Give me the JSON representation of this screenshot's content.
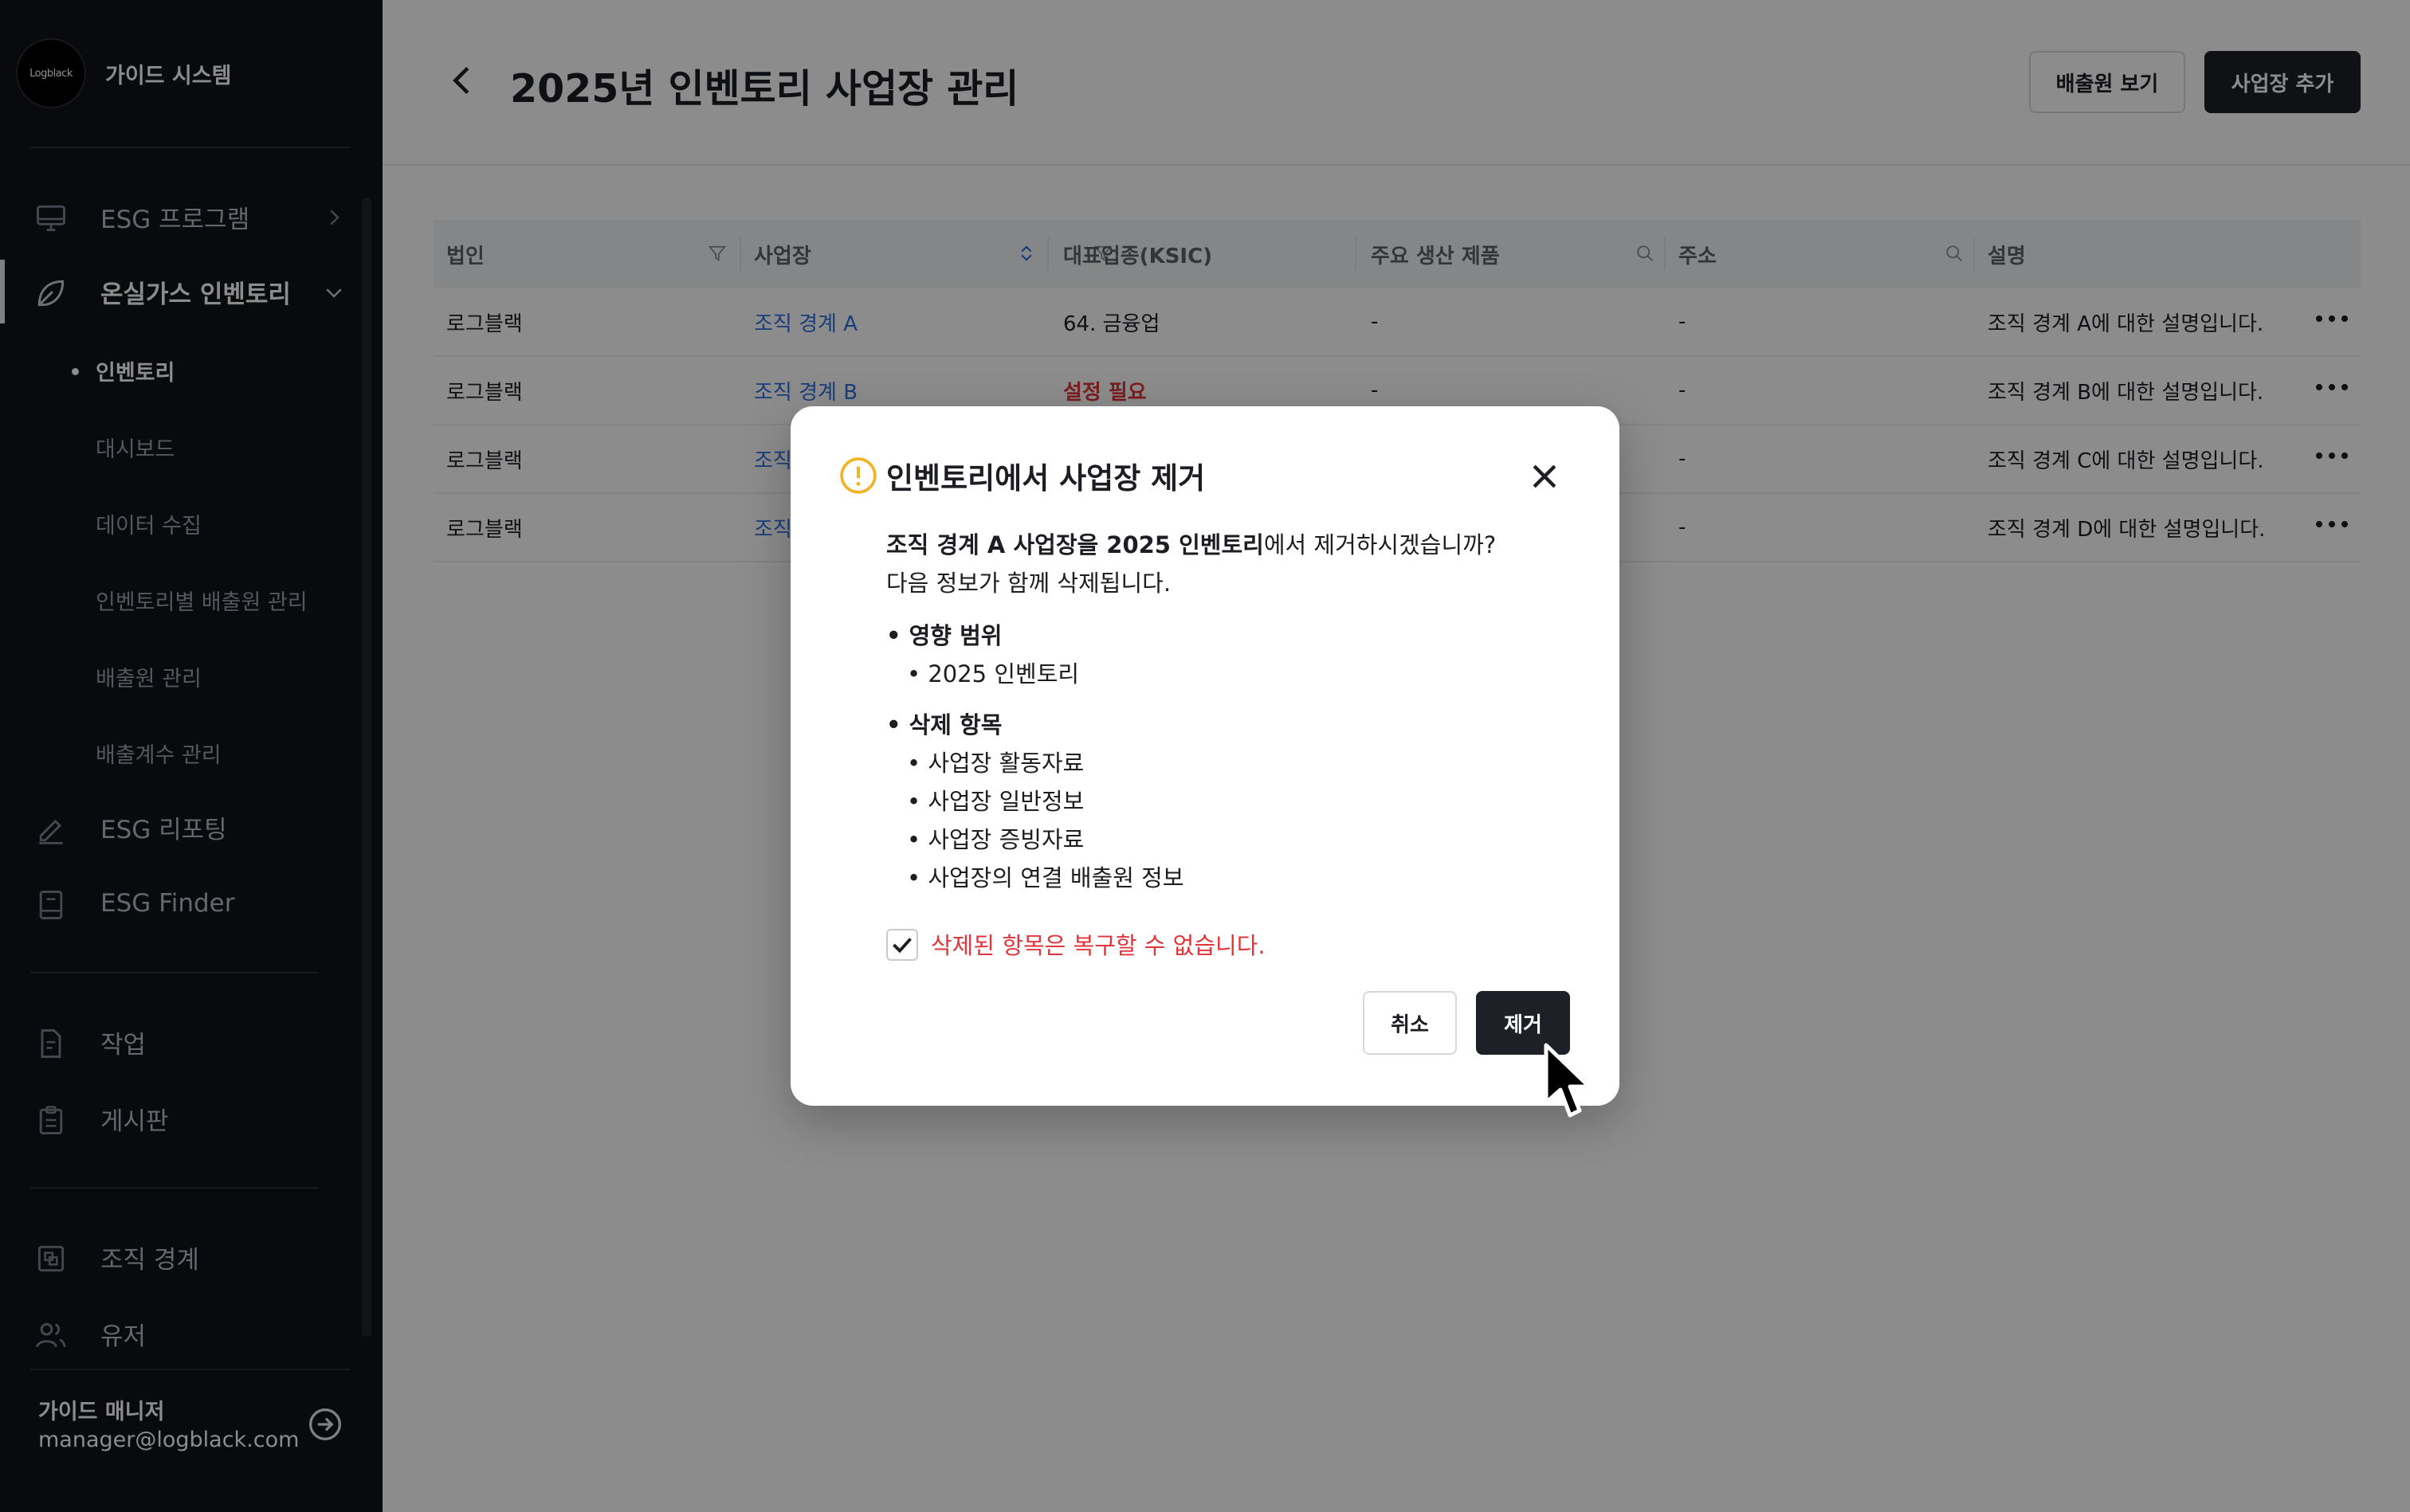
{
  "sidebar": {
    "brand_logo": "Logblack",
    "brand_title": "가이드 시스템",
    "items": [
      {
        "label": "ESG 프로그램",
        "icon": "monitor-icon"
      },
      {
        "label": "온실가스 인벤토리",
        "icon": "leaf-icon"
      },
      {
        "label": "ESG 리포팅",
        "icon": "pen-icon"
      },
      {
        "label": "ESG Finder",
        "icon": "book-icon"
      },
      {
        "label": "작업",
        "icon": "file-edit-icon"
      },
      {
        "label": "게시판",
        "icon": "clipboard-icon"
      },
      {
        "label": "조직 경계",
        "icon": "layers-icon"
      },
      {
        "label": "유저",
        "icon": "users-icon"
      }
    ],
    "sub_items": [
      "인벤토리",
      "대시보드",
      "데이터 수집",
      "인벤토리별 배출원 관리",
      "배출원 관리",
      "배출계수 관리"
    ],
    "user": {
      "name": "가이드 매니저",
      "email": "manager@logblack.com"
    }
  },
  "header": {
    "title": "2025년 인벤토리 사업장 관리",
    "view_sources_label": "배출원 보기",
    "add_site_label": "사업장 추가"
  },
  "table": {
    "columns": [
      "법인",
      "사업장",
      "대표업종(KSIC)",
      "주요 생산 제품",
      "주소",
      "설명"
    ],
    "rows": [
      {
        "corp": "로그블랙",
        "site": "조직 경계 A",
        "industry": "64. 금융업",
        "product": "-",
        "address": "-",
        "desc": "조직 경계 A에 대한 설명입니다."
      },
      {
        "corp": "로그블랙",
        "site": "조직 경계 B",
        "industry": "설정 필요",
        "product": "-",
        "address": "-",
        "desc": "조직 경계 B에 대한 설명입니다."
      },
      {
        "corp": "로그블랙",
        "site": "조직 경계 C",
        "industry": "",
        "product": "",
        "address": "-",
        "desc": "조직 경계 C에 대한 설명입니다."
      },
      {
        "corp": "로그블랙",
        "site": "조직 경계 D",
        "industry": "",
        "product": "",
        "address": "-",
        "desc": "조직 경계 D에 대한 설명입니다."
      }
    ]
  },
  "modal": {
    "title": "인벤토리에서 사업장 제거",
    "question_bold": "조직 경계 A 사업장을 2025 인벤토리",
    "question_rest": "에서 제거하시겠습니까?",
    "subtitle": "다음 정보가 함께 삭제됩니다.",
    "scope_heading": "• 영향 범위",
    "scope_items": [
      "• 2025 인벤토리"
    ],
    "delete_heading": "• 삭제 항목",
    "delete_items": [
      "• 사업장 활동자료",
      "• 사업장 일반정보",
      "• 사업장 증빙자료",
      "• 사업장의 연결 배출원 정보"
    ],
    "confirm_text": "삭제된 항목은 복구할 수 없습니다.",
    "cancel_label": "취소",
    "remove_label": "제거"
  },
  "colors": {
    "sidebar_bg": "#111319",
    "accent_dark": "#1d2027",
    "link_blue": "#2f6fe0",
    "warning_red": "#e0353a",
    "warning_yellow": "#f0b429"
  }
}
